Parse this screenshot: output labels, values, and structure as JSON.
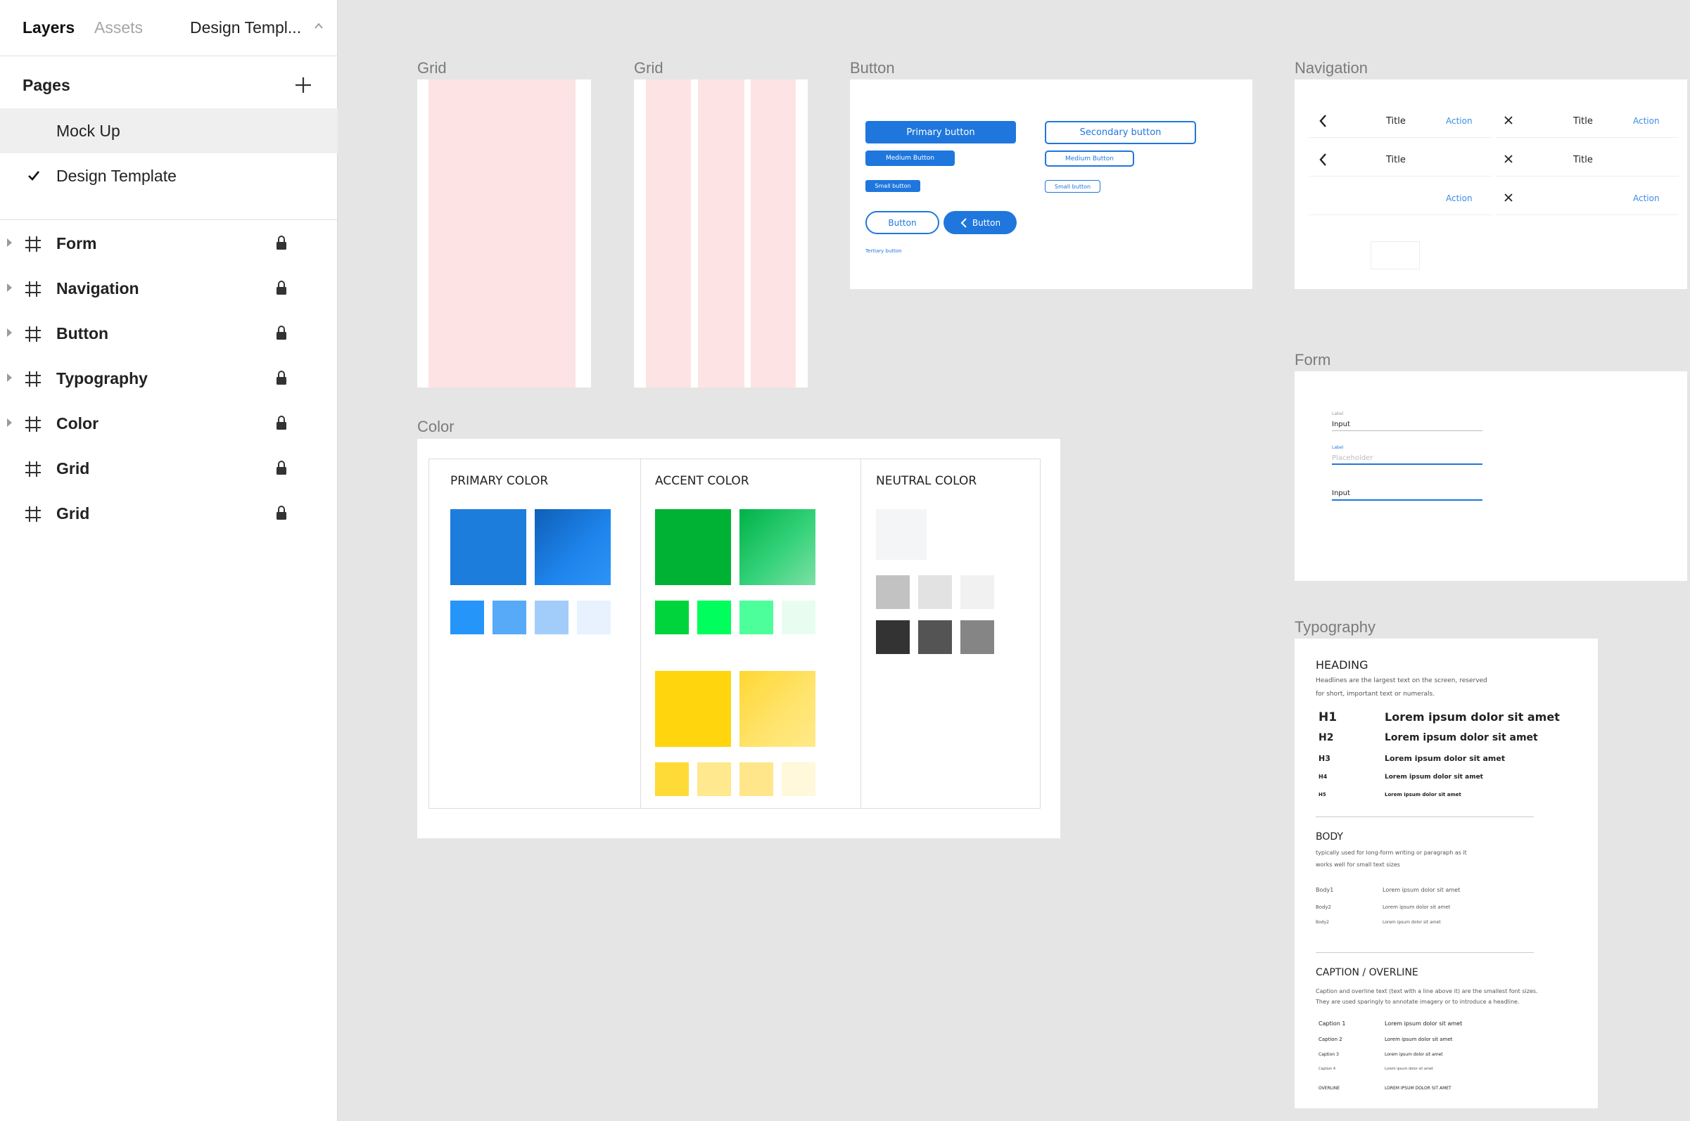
{
  "sidebar": {
    "tabs": {
      "layers": "Layers",
      "assets": "Assets",
      "page_select": "Design Templ..."
    },
    "pages_title": "Pages",
    "pages": [
      {
        "label": "Mock Up",
        "selected": true
      },
      {
        "label": "Design Template",
        "checked": true
      }
    ],
    "layers": [
      {
        "label": "Form",
        "icon": "hash-icon",
        "locked": true,
        "expandable": true
      },
      {
        "label": "Navigation",
        "icon": "hash-icon",
        "locked": true,
        "expandable": true
      },
      {
        "label": "Button",
        "icon": "hash-icon",
        "locked": true,
        "expandable": true
      },
      {
        "label": "Typography",
        "icon": "hash-icon",
        "locked": true,
        "expandable": true
      },
      {
        "label": "Color",
        "icon": "hash-icon",
        "locked": true,
        "expandable": true
      },
      {
        "label": "Grid",
        "icon": "hash-icon",
        "locked": true,
        "expandable": false
      },
      {
        "label": "Grid",
        "icon": "hash-icon",
        "locked": true,
        "expandable": false
      }
    ]
  },
  "canvas": {
    "grid1": {
      "label": "Grid"
    },
    "grid2": {
      "label": "Grid"
    },
    "button": {
      "label": "Button",
      "primary": "Primary button",
      "secondary": "Secondary button",
      "medium_primary": "Medium Button",
      "medium_secondary": "Medium Button",
      "small_primary": "Small button",
      "small_secondary": "Small button",
      "outline_round": "Button",
      "icon_round": "Button",
      "tertiary": "Tertiary button"
    },
    "navigation": {
      "label": "Navigation",
      "left": {
        "row1_title": "Title",
        "row1_action": "Action",
        "row2_title": "Title",
        "row3_action": "Action"
      },
      "right": {
        "row1_title": "Title",
        "row1_action": "Action",
        "row2_title": "Title",
        "row3_action": "Action"
      }
    },
    "form": {
      "label": "Form",
      "field1_label": "Label",
      "field1_value": "Input",
      "field2_label": "Label",
      "field2_placeholder": "Placeholder",
      "field3_value": "Input"
    },
    "color": {
      "label": "Color",
      "primary_title": "PRIMARY COLOR",
      "accent_title": "ACCENT COLOR",
      "neutral_title": "NEUTRAL COLOR",
      "primary_large": [
        "#1c7ddc",
        "#1f86ee"
      ],
      "primary_small": [
        "#2595fa",
        "#57aaf7",
        "#a2cdfb",
        "#e8f2fe"
      ],
      "accent_green_large": [
        "#00b234",
        "#35d27a"
      ],
      "accent_green_small": [
        "#00d43c",
        "#00ff5c",
        "#4cff9a",
        "#e8fdef"
      ],
      "accent_yellow_large": [
        "#ffd50d",
        "#ffe36a"
      ],
      "accent_yellow_small": [
        "#ffdb37",
        "#ffe88d",
        "#ffe68a",
        "#fff8da"
      ],
      "neutral_top": "#f4f5f7",
      "neutral_mid": [
        "#c2c2c2",
        "#e2e2e2",
        "#f1f1f1"
      ],
      "neutral_bottom": [
        "#333333",
        "#545454",
        "#858585"
      ]
    },
    "typography": {
      "label": "Typography",
      "heading_title": "HEADING",
      "heading_desc1": "Headlines are the largest text on the screen, reserved",
      "heading_desc2": "for short, important text or numerals.",
      "headings": [
        {
          "tag": "H1",
          "sample": "Lorem ipsum dolor sit amet"
        },
        {
          "tag": "H2",
          "sample": "Lorem ipsum dolor sit amet"
        },
        {
          "tag": "H3",
          "sample": "Lorem ipsum dolor sit amet"
        },
        {
          "tag": "H4",
          "sample": "Lorem ipsum dolor sit amet"
        },
        {
          "tag": "H5",
          "sample": "Lorem ipsum dolor sit amet"
        }
      ],
      "body_title": "BODY",
      "body_desc1": "typically used for long-form writing or paragraph as it",
      "body_desc2": "works well for small text sizes",
      "bodies": [
        {
          "tag": "Body1",
          "sample": "Lorem ipsum dolor sit amet"
        },
        {
          "tag": "Body2",
          "sample": "Lorem ipsum dolor sit amet"
        },
        {
          "tag": "Body2",
          "sample": "Lorem ipsum dolor sit amet"
        }
      ],
      "caption_title": "CAPTION / OVERLINE",
      "caption_desc1": "Caption and overline text (text with a line above it) are the smallest font sizes.",
      "caption_desc2": "They are used sparingly to annotate imagery or to introduce a headline.",
      "captions": [
        {
          "tag": "Caption 1",
          "sample": "Lorem ipsum dolor sit amet"
        },
        {
          "tag": "Caption 2",
          "sample": "Lorem ipsum dolor sit amet"
        },
        {
          "tag": "Caption 3",
          "sample": "Lorem ipsum dolor sit amet"
        },
        {
          "tag": "Caption 4",
          "sample": "Lorem ipsum dolor sit amet"
        },
        {
          "tag": "OVERLINE",
          "sample": "LOREM IPSUM DOLOR SIT AMET"
        }
      ]
    }
  },
  "colors": {
    "accent": "#1f77dd",
    "grid_column": "#fde3e3"
  }
}
